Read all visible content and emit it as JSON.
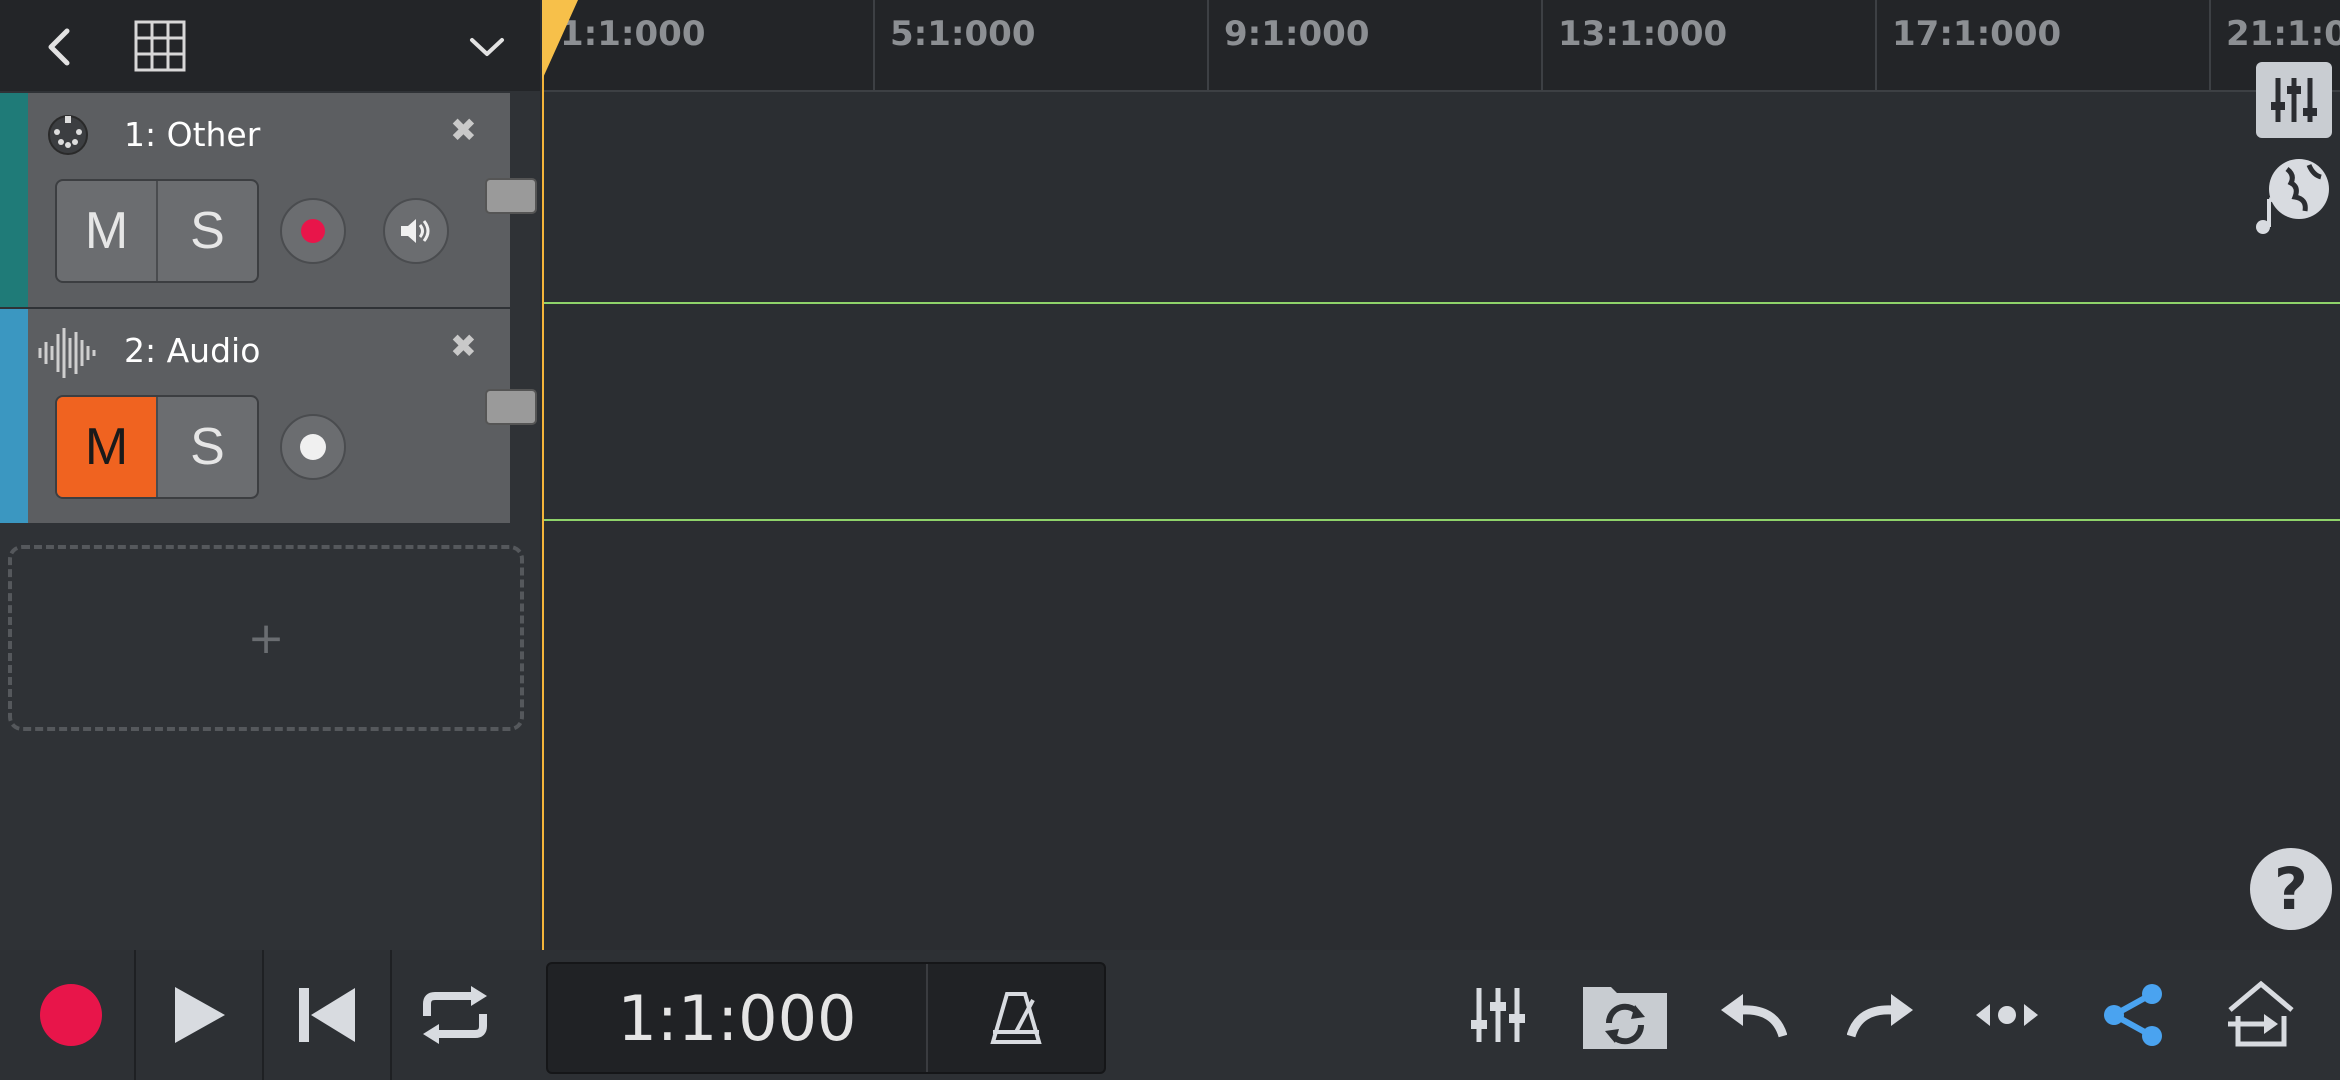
{
  "header": {
    "back_icon": "chevron-left-icon",
    "grid_icon": "grid-icon",
    "menu_icon": "chevron-down-icon"
  },
  "tracks": [
    {
      "name": "1: Other",
      "color": "#1f7b78",
      "mute": "M",
      "solo": "S",
      "muted": false,
      "armed": true,
      "has_monitor": true
    },
    {
      "name": "2: Audio",
      "color": "#3b97c1",
      "mute": "M",
      "solo": "S",
      "muted": true,
      "armed": false,
      "has_monitor": false
    }
  ],
  "add_track": {
    "label": "+"
  },
  "ruler": {
    "labels": [
      "1:1:000",
      "5:1:000",
      "9:1:000",
      "13:1:000",
      "17:1:000",
      "21:1:000"
    ]
  },
  "transport": {
    "time": "1:1:000"
  },
  "colors": {
    "accent": "#f06320",
    "record": "#e8154a",
    "share": "#4aa3f0",
    "lane_line": "#8fd36a",
    "playhead": "#f3b43a"
  }
}
